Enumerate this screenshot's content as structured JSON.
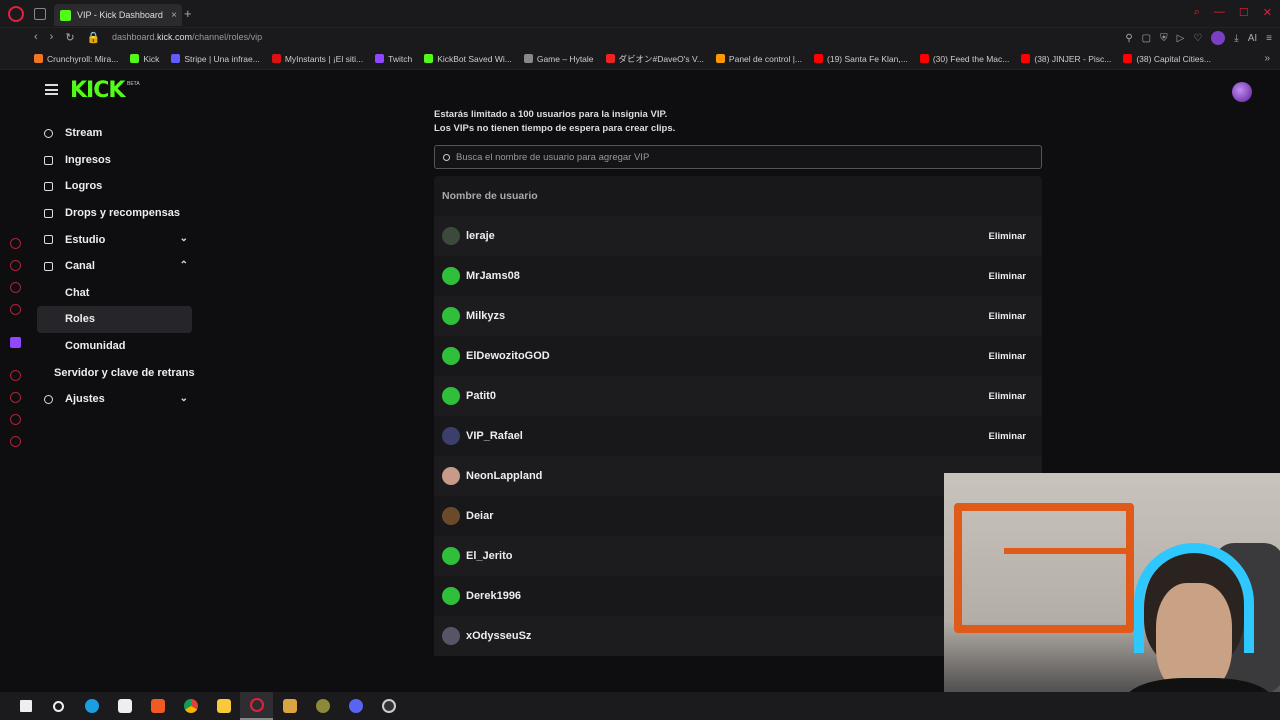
{
  "browser": {
    "tab_title": "VIP - Kick Dashboard",
    "url_prefix": "dashboard.",
    "url_domain": "kick.com",
    "url_path": "/channel/roles/vip",
    "ai_label": "AI",
    "bookmarks": [
      {
        "label": "Crunchyroll: Mira...",
        "color": "#f47521"
      },
      {
        "label": "Kick",
        "color": "#53fc18"
      },
      {
        "label": "Stripe | Una infrae...",
        "color": "#635bff"
      },
      {
        "label": "MyInstants | ¡El siti...",
        "color": "#d11"
      },
      {
        "label": "Twitch",
        "color": "#9146ff"
      },
      {
        "label": "KickBot Saved Wi...",
        "color": "#53fc18"
      },
      {
        "label": "Game – Hytale",
        "color": "#888"
      },
      {
        "label": "ダビオン#DaveO's V...",
        "color": "#e22"
      },
      {
        "label": "Panel de control |...",
        "color": "#f90"
      },
      {
        "label": "(19) Santa Fe Klan,...",
        "color": "#f00"
      },
      {
        "label": "(30) Feed the Mac...",
        "color": "#f00"
      },
      {
        "label": "(38) JINJER - Pisc...",
        "color": "#f00"
      },
      {
        "label": "(38) Capital Cities...",
        "color": "#f00"
      }
    ]
  },
  "header": {
    "logo": "KICK",
    "beta": "BETA"
  },
  "sidebar": {
    "items": [
      {
        "label": "Stream",
        "icon": "broadcast-icon"
      },
      {
        "label": "Ingresos",
        "icon": "revenue-icon"
      },
      {
        "label": "Logros",
        "icon": "trophy-icon"
      },
      {
        "label": "Drops y recompensas",
        "icon": "gift-icon"
      },
      {
        "label": "Estudio",
        "icon": "studio-icon"
      },
      {
        "label": "Canal",
        "icon": "channel-icon"
      },
      {
        "label": "Chat"
      },
      {
        "label": "Roles"
      },
      {
        "label": "Comunidad"
      },
      {
        "label": "Servidor y clave de retrans"
      },
      {
        "label": "Ajustes",
        "icon": "gear-icon"
      }
    ]
  },
  "main": {
    "info_line1": "Estarás limitado a 100 usuarios para la insignia VIP.",
    "info_line2": "Los VIPs no tienen tiempo de espera para crear clips.",
    "search_placeholder": "Busca el nombre de usuario para agregar VIP",
    "column_header": "Nombre de usuario",
    "remove_label": "Eliminar",
    "users": [
      {
        "name": "leraje",
        "avatar_color": "#3b4a3a"
      },
      {
        "name": "MrJams08",
        "avatar_color": "#2fbf3a"
      },
      {
        "name": "Milkyzs",
        "avatar_color": "#2fbf3a"
      },
      {
        "name": "ElDewozitoGOD",
        "avatar_color": "#2fbf3a"
      },
      {
        "name": "Patit0",
        "avatar_color": "#2fbf3a"
      },
      {
        "name": "VIP_Rafael",
        "avatar_color": "#3b3f6a"
      },
      {
        "name": "NeonLappland",
        "avatar_color": "#c89a8a"
      },
      {
        "name": "Deiar",
        "avatar_color": "#6a4a2a"
      },
      {
        "name": "El_Jerito",
        "avatar_color": "#2fbf3a"
      },
      {
        "name": "Derek1996",
        "avatar_color": "#2fbf3a"
      },
      {
        "name": "xOdysseuSz",
        "avatar_color": "#556"
      }
    ]
  },
  "taskbar": {
    "apps": [
      "windows-start-icon",
      "search-icon",
      "edge-icon",
      "store-icon",
      "brave-icon",
      "chrome-icon",
      "file-explorer-icon",
      "opera-icon",
      "media-icon",
      "game-icon",
      "discord-icon",
      "obs-icon"
    ]
  }
}
